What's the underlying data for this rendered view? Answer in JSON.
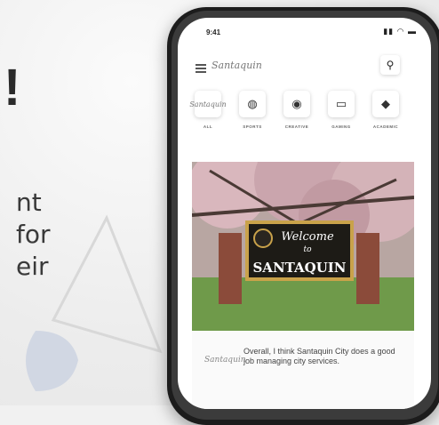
{
  "left": {
    "exclaim": "!",
    "lines": [
      "nt",
      " for",
      "eir"
    ]
  },
  "phone": {
    "status": {
      "time": "9:41",
      "icons": "▮▮ ◠ ▬"
    },
    "header": {
      "logo": "Santaquin"
    },
    "categories": [
      {
        "label": "ALL",
        "icon": "logo"
      },
      {
        "label": "SPORTS",
        "icon": "basketball-icon"
      },
      {
        "label": "CREATIVE",
        "icon": "palette-icon"
      },
      {
        "label": "GAMING",
        "icon": "gamepad-icon"
      },
      {
        "label": "ACADEMIC",
        "icon": "graduation-cap-icon"
      }
    ],
    "sign": {
      "welcome": "Welcome",
      "to": "to",
      "city": "SANTAQUIN"
    },
    "caption": {
      "logo": "Santaquin",
      "text": "Overall, I think Santaquin City does a good job managing city services."
    }
  },
  "colors": {
    "sign_border": "#c9a24a",
    "sign_bg": "#1d1b16",
    "brick": "#8b4b3a",
    "grass": "#6f9a4a"
  }
}
